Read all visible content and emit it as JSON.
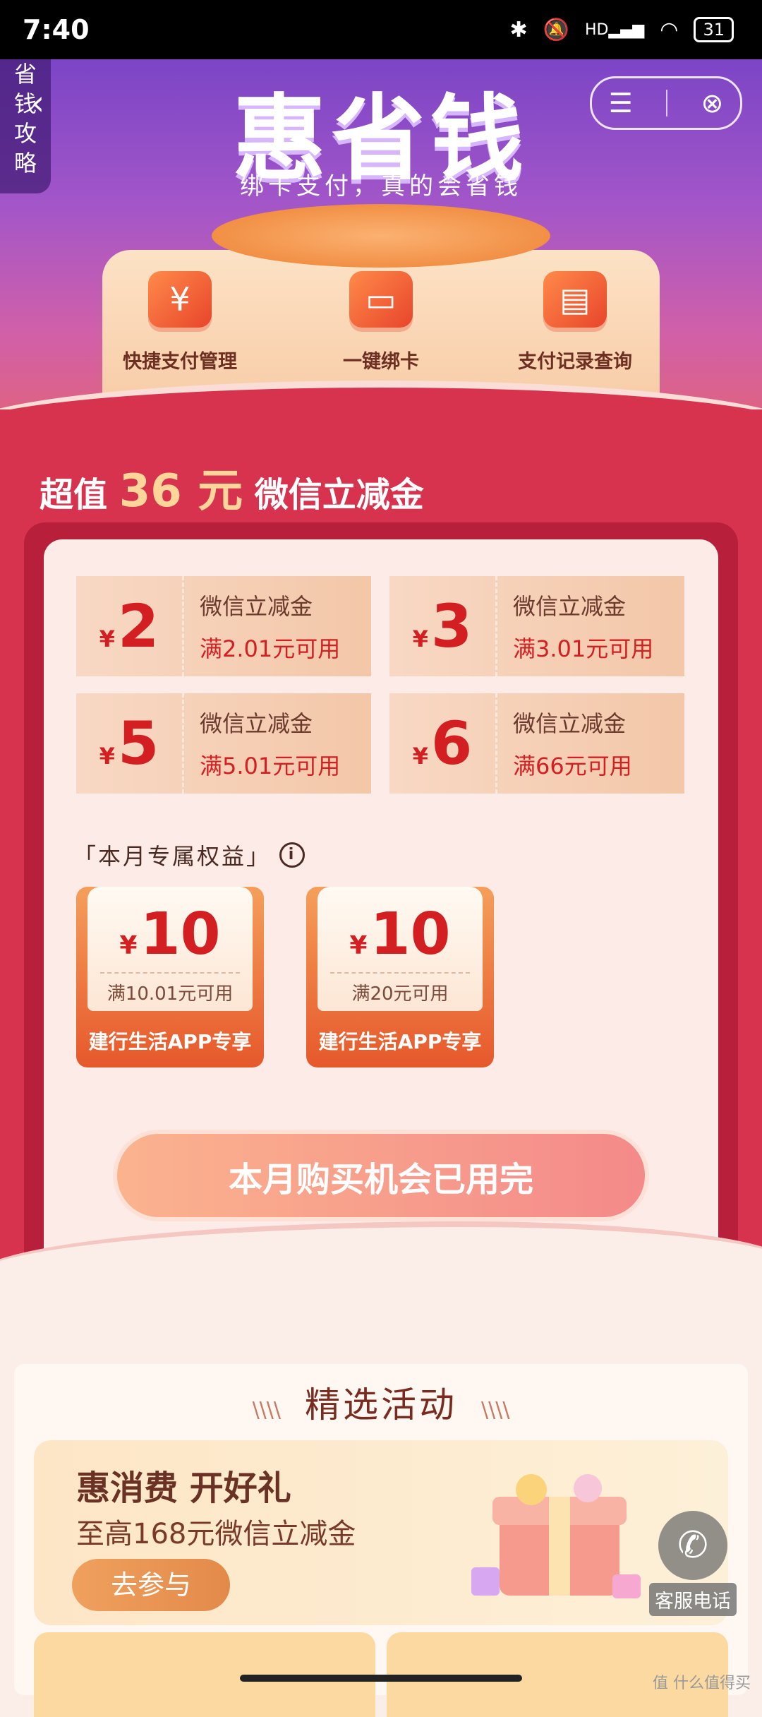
{
  "status_bar": {
    "time": "7:40",
    "icons": [
      "bluetooth-icon",
      "mute-icon",
      "signal-icon",
      "wifi-icon"
    ],
    "hd": "HD",
    "battery": "31"
  },
  "side_tab": {
    "chars": [
      "省",
      "钱",
      "攻",
      "略"
    ]
  },
  "hero": {
    "title": "惠省钱",
    "subtitle": "绑卡支付，真的会省钱",
    "actions": [
      {
        "label": "快捷支付管理",
        "icon": "wallet-icon"
      },
      {
        "label": "一键绑卡",
        "icon": "bind-card-icon"
      },
      {
        "label": "支付记录查询",
        "icon": "record-icon"
      }
    ]
  },
  "promo": {
    "prefix": "超值",
    "amount": "36 元",
    "suffix": "微信立减金"
  },
  "coupons": [
    {
      "value": "2",
      "name": "微信立减金",
      "condition": "满2.01元可用"
    },
    {
      "value": "3",
      "name": "微信立减金",
      "condition": "满3.01元可用"
    },
    {
      "value": "5",
      "name": "微信立减金",
      "condition": "满5.01元可用"
    },
    {
      "value": "6",
      "name": "微信立减金",
      "condition": "满66元可用"
    }
  ],
  "currency_symbol": "¥",
  "exclusive": {
    "title": "「本月专属权益」",
    "items": [
      {
        "value": "10",
        "condition": "满10.01元可用",
        "label": "建行生活APP专享"
      },
      {
        "value": "10",
        "condition": "满20元可用",
        "label": "建行生活APP专享"
      }
    ]
  },
  "buy_button": "本月购买机会已用完",
  "activities": {
    "heading": "精选活动",
    "card": {
      "title": "惠消费 开好礼",
      "subtitle": "至高168元微信立减金",
      "button": "去参与"
    }
  },
  "service": {
    "label": "客服电话"
  },
  "watermark": "值 什么值得买",
  "colors": {
    "accent_red": "#d8334e",
    "coupon_red": "#d41f22",
    "hero_purple": "#7b45c6"
  }
}
